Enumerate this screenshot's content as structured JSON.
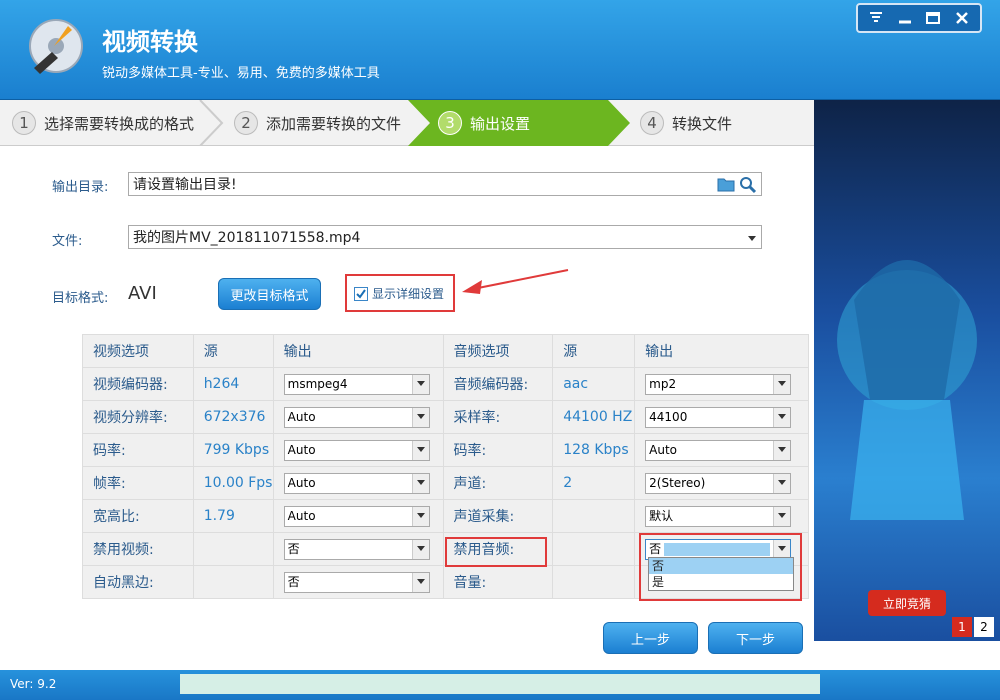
{
  "header": {
    "title": "视频转换",
    "subtitle": "锐动多媒体工具-专业、易用、免费的多媒体工具"
  },
  "window_buttons": [
    "menu-icon",
    "minimize-icon",
    "maximize-icon",
    "close-icon"
  ],
  "steps": [
    {
      "num": "1",
      "label": "选择需要转换成的格式"
    },
    {
      "num": "2",
      "label": "添加需要转换的文件"
    },
    {
      "num": "3",
      "label": "输出设置"
    },
    {
      "num": "4",
      "label": "转换文件"
    }
  ],
  "output": {
    "dir_label": "输出目录:",
    "dir_value": "请设置输出目录!",
    "file_label": "文件:",
    "file_value": "我的图片MV_201811071558.mp4"
  },
  "target": {
    "label": "目标格式:",
    "value": "AVI",
    "change_button": "更改目标格式",
    "show_detail": "显示详细设置"
  },
  "table": {
    "headers": [
      "视频选项",
      "源",
      "输出",
      "音频选项",
      "源",
      "输出"
    ],
    "rows": [
      {
        "vlabel": "视频编码器:",
        "vsrc": "h264",
        "vout": "msmpeg4",
        "alabel": "音频编码器:",
        "asrc": "aac",
        "aout": "mp2"
      },
      {
        "vlabel": "视频分辨率:",
        "vsrc": "672x376",
        "vout": "Auto",
        "alabel": "采样率:",
        "asrc": "44100 HZ",
        "aout": "44100"
      },
      {
        "vlabel": "码率:",
        "vsrc": "799 Kbps",
        "vout": "Auto",
        "alabel": "码率:",
        "asrc": "128 Kbps",
        "aout": "Auto"
      },
      {
        "vlabel": "帧率:",
        "vsrc": "10.00 Fps",
        "vout": "Auto",
        "alabel": "声道:",
        "asrc": "2",
        "aout": "2(Stereo)"
      },
      {
        "vlabel": "宽高比:",
        "vsrc": "1.79",
        "vout": "Auto",
        "alabel": "声道采集:",
        "asrc": "",
        "aout": "默认"
      },
      {
        "vlabel": "禁用视频:",
        "vsrc": "",
        "vout": "否",
        "alabel": "禁用音频:",
        "asrc": "",
        "aout": "否"
      },
      {
        "vlabel": "自动黑边:",
        "vsrc": "",
        "vout": "否",
        "alabel": "音量:",
        "asrc": "",
        "aout": ""
      }
    ],
    "dropdown_options": [
      "否",
      "是"
    ]
  },
  "nav": {
    "prev": "上一步",
    "next": "下一步"
  },
  "ad": {
    "pages": [
      "1",
      "2"
    ],
    "cta": "立即竞猜"
  },
  "footer": {
    "version": "Ver: 9.2"
  },
  "colors": {
    "accent": "#1a7fcf",
    "step_active": "#6cb620",
    "annotation": "#e03a3a"
  }
}
